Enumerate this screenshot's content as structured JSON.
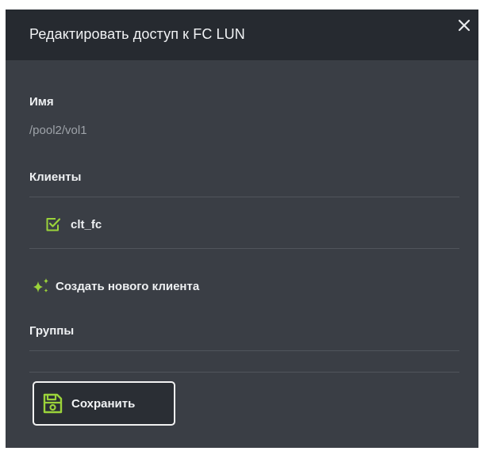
{
  "dialog": {
    "title": "Редактировать доступ к FC LUN"
  },
  "name_section": {
    "label": "Имя",
    "value": "/pool2/vol1"
  },
  "clients_section": {
    "label": "Клиенты",
    "items": [
      {
        "name": "clt_fc",
        "checked": true
      }
    ]
  },
  "create_client": {
    "label": "Создать нового клиента"
  },
  "groups_section": {
    "label": "Группы"
  },
  "save_button": {
    "label": "Сохранить"
  },
  "icons": {
    "close": "close-icon",
    "checkbox": "checkbox-checked-icon",
    "sparkle": "sparkle-icon",
    "save": "floppy-disk-icon"
  },
  "colors": {
    "accent": "#9bd33a",
    "panel_bg": "#3a3e45",
    "header_bg": "#262a30"
  }
}
